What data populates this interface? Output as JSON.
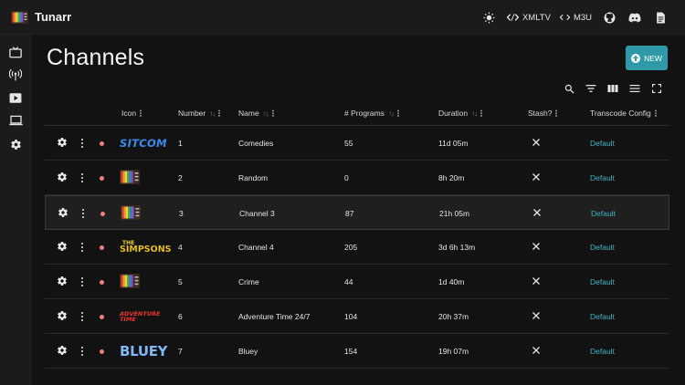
{
  "app": {
    "title": "Tunarr"
  },
  "topbar": {
    "actions": [
      {
        "icon": "theme-brightness-icon"
      },
      {
        "label": "XMLTV",
        "icon": "code-icon"
      },
      {
        "label": "M3U",
        "icon": "code-icon"
      },
      {
        "icon": "github-icon"
      },
      {
        "icon": "discord-icon"
      },
      {
        "icon": "docs-icon"
      }
    ]
  },
  "sidebar": {
    "items": [
      {
        "icon": "tv-icon"
      },
      {
        "icon": "antenna-icon"
      },
      {
        "icon": "video-library-icon"
      },
      {
        "icon": "computer-icon"
      },
      {
        "icon": "settings-icon"
      }
    ]
  },
  "page": {
    "title": "Channels",
    "new_button": "NEW"
  },
  "toolbar": {
    "icons": [
      "search-icon",
      "filter-icon",
      "columns-icon",
      "density-icon",
      "fullscreen-icon"
    ]
  },
  "table": {
    "columns": {
      "icon": "Icon",
      "number": "Number",
      "name": "Name",
      "programs": "# Programs",
      "duration": "Duration",
      "stash": "Stash?",
      "transcode": "Transcode Config"
    },
    "rows": [
      {
        "number": "1",
        "name": "Comedies",
        "programs": "55",
        "duration": "11d 05m",
        "transcode": "Default",
        "icon": "sitcom-logo",
        "icon_text": "SITCOM"
      },
      {
        "number": "2",
        "name": "Random",
        "programs": "0",
        "duration": "8h 20m",
        "transcode": "Default",
        "icon": "tunarr-tv-logo"
      },
      {
        "number": "3",
        "name": "Channel 3",
        "programs": "87",
        "duration": "21h 05m",
        "transcode": "Default",
        "icon": "tunarr-tv-logo"
      },
      {
        "number": "4",
        "name": "Channel 4",
        "programs": "205",
        "duration": "3d 6h 13m",
        "transcode": "Default",
        "icon": "simpsons-logo",
        "icon_text_top": "THE",
        "icon_text": "SIMPSONS"
      },
      {
        "number": "5",
        "name": "Crime",
        "programs": "44",
        "duration": "1d 40m",
        "transcode": "Default",
        "icon": "tunarr-tv-logo"
      },
      {
        "number": "6",
        "name": "Adventure Time 24/7",
        "programs": "104",
        "duration": "20h 37m",
        "transcode": "Default",
        "icon": "adventure-time-logo",
        "icon_text": "ADVENTURE TIME"
      },
      {
        "number": "7",
        "name": "Bluey",
        "programs": "154",
        "duration": "19h 07m",
        "transcode": "Default",
        "icon": "bluey-logo",
        "icon_text": "BLUEY"
      }
    ],
    "highlighted_row_number": "3"
  },
  "colors": {
    "background": "#121212",
    "bar": "#1b1b1b",
    "accent": "#2f9aa7",
    "link": "#3fb5c4",
    "status_dot": "#ef7e7e"
  }
}
